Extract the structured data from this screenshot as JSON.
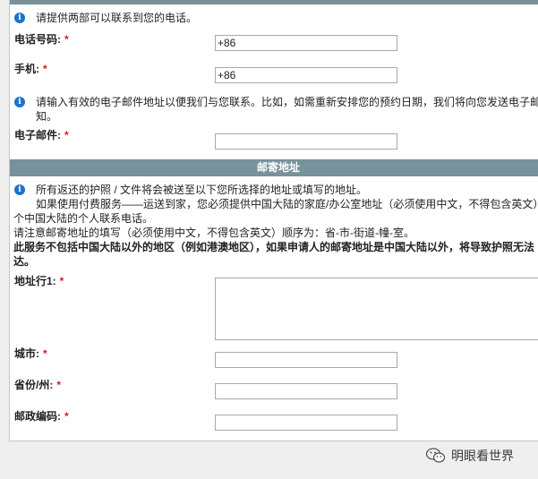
{
  "contact": {
    "phone_note": "请提供两部可以联系到您的电话。",
    "phone_label": "电话号码:",
    "phone_value": "+86",
    "mobile_label": "手机:",
    "mobile_value": "+86",
    "email_note_line1": "请输入有效的电子邮件地址以便我们与您联系。比如，如需重新安排您的预约日期，我们将向您发送电子邮",
    "email_note_line2": "知。",
    "email_label": "电子邮件:",
    "email_value": ""
  },
  "mailing": {
    "header": "邮寄地址",
    "note_line1": "所有返还的护照 / 文件将会被送至以下您所选择的地址或填写的地址。",
    "note_line2": "如果使用付费服务——运送到家，您必须提供中国大陆的家庭/办公室地址（必须使用中文，不得包含英文）",
    "note_line3": "个中国大陆的个人联系电话。",
    "note_line4": "请注意邮寄地址的填写（必须使用中文，不得包含英文）顺序为：省-市-街道-幢-室。",
    "bold_line1": "此服务不包括中国大陆以外的地区（例如港澳地区），如果申请人的邮寄地址是中国大陆以外，将导致护照无法",
    "bold_line2": "达。",
    "address_label": "地址行1:",
    "address_value": "",
    "city_label": "城市:",
    "city_value": "",
    "province_label": "省份/州:",
    "province_value": "",
    "postal_label": "邮政编码:",
    "postal_value": ""
  },
  "required_mark": "*",
  "watermark": {
    "text": "明眼看世界",
    "icon": "wechat-icon"
  },
  "colors": {
    "header_bg": "#77929a",
    "info_icon": "#1c73cb",
    "required": "#d21b1b"
  }
}
